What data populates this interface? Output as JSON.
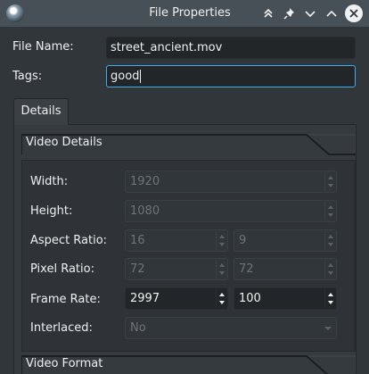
{
  "window": {
    "title": "File Properties",
    "buttons": [
      "keep-above-icon",
      "pin-icon",
      "minimize-icon",
      "maximize-icon",
      "close-icon"
    ]
  },
  "form": {
    "file_name_label": "File Name:",
    "file_name_value": "street_ancient.mov",
    "tags_label": "Tags:",
    "tags_value": "good"
  },
  "tabs": [
    {
      "label": "Details"
    }
  ],
  "video_details": {
    "title": "Video Details",
    "width": {
      "label": "Width:",
      "value": "1920"
    },
    "height": {
      "label": "Height:",
      "value": "1080"
    },
    "aspect_ratio": {
      "label": "Aspect Ratio:",
      "value_a": "16",
      "value_b": "9"
    },
    "pixel_ratio": {
      "label": "Pixel Ratio:",
      "value_a": "72",
      "value_b": "72"
    },
    "frame_rate": {
      "label": "Frame Rate:",
      "value_a": "2997",
      "value_b": "100"
    },
    "interlaced": {
      "label": "Interlaced:",
      "value": "No"
    }
  },
  "video_format": {
    "title": "Video Format"
  },
  "colors": {
    "background": "#31363b",
    "accent": "#3daee9",
    "titlebar": "#475057"
  }
}
